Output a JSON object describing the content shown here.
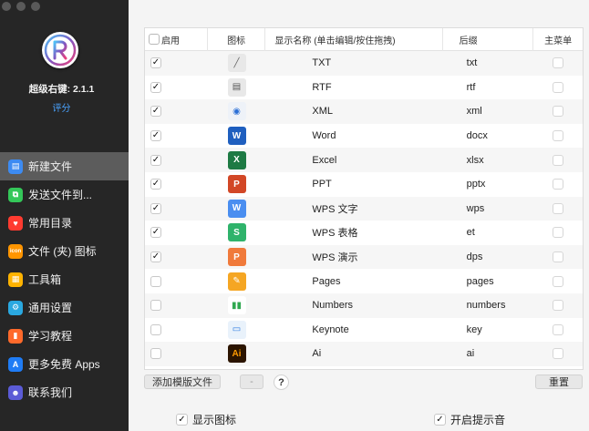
{
  "app": {
    "name": "超级右键: 2.1.1",
    "rate": "评分"
  },
  "nav": [
    {
      "label": "新建文件",
      "icon": "document-icon",
      "color": "#3d8bf2",
      "glyph": "▤",
      "active": true
    },
    {
      "label": "发送文件到...",
      "icon": "send-file-icon",
      "color": "#34c759",
      "glyph": "⧉",
      "active": false
    },
    {
      "label": "常用目录",
      "icon": "heart-icon",
      "color": "#ff3b30",
      "glyph": "♥",
      "active": false
    },
    {
      "label": "文件 (夹) 图标",
      "icon": "icon-badge-icon",
      "color": "#ff9500",
      "glyph": "icon",
      "active": false
    },
    {
      "label": "工具箱",
      "icon": "toolbox-icon",
      "color": "#ffb300",
      "glyph": "▦",
      "active": false
    },
    {
      "label": "通用设置",
      "icon": "gear-icon",
      "color": "#2aa8e0",
      "glyph": "⚙",
      "active": false
    },
    {
      "label": "学习教程",
      "icon": "book-icon",
      "color": "#ff6a2b",
      "glyph": "▮",
      "active": false
    },
    {
      "label": "更多免费 Apps",
      "icon": "app-store-icon",
      "color": "#1f7cf5",
      "glyph": "A",
      "active": false
    },
    {
      "label": "联系我们",
      "icon": "contact-icon",
      "color": "#5b5bd6",
      "glyph": "☻",
      "active": false
    }
  ],
  "table": {
    "headers": {
      "enabled": "启用",
      "icon": "图标",
      "name": "显示名称 (单击编辑/按住拖拽)",
      "suffix": "后缀",
      "main_menu": "主菜单"
    },
    "rows": [
      {
        "enabled": true,
        "name": "TXT",
        "suffix": "txt",
        "icon": "txt-file-icon",
        "color": "#e8e8e8",
        "glyph": "╱",
        "fg": "#666"
      },
      {
        "enabled": true,
        "name": "RTF",
        "suffix": "rtf",
        "icon": "rtf-file-icon",
        "color": "#e8e8e8",
        "glyph": "▤",
        "fg": "#555"
      },
      {
        "enabled": true,
        "name": "XML",
        "suffix": "xml",
        "icon": "xml-file-icon",
        "color": "#eef2f8",
        "glyph": "◉",
        "fg": "#2b6fd6"
      },
      {
        "enabled": true,
        "name": "Word",
        "suffix": "docx",
        "icon": "word-icon",
        "color": "#1f5fbf",
        "glyph": "W",
        "fg": "#fff"
      },
      {
        "enabled": true,
        "name": "Excel",
        "suffix": "xlsx",
        "icon": "excel-icon",
        "color": "#1e7a44",
        "glyph": "X",
        "fg": "#fff"
      },
      {
        "enabled": true,
        "name": "PPT",
        "suffix": "pptx",
        "icon": "powerpoint-icon",
        "color": "#d24726",
        "glyph": "P",
        "fg": "#fff"
      },
      {
        "enabled": true,
        "name": "WPS 文字",
        "suffix": "wps",
        "icon": "wps-writer-icon",
        "color": "#4a8ef0",
        "glyph": "W",
        "fg": "#fff"
      },
      {
        "enabled": true,
        "name": "WPS 表格",
        "suffix": "et",
        "icon": "wps-sheet-icon",
        "color": "#2fb36b",
        "glyph": "S",
        "fg": "#fff"
      },
      {
        "enabled": true,
        "name": "WPS 演示",
        "suffix": "dps",
        "icon": "wps-slides-icon",
        "color": "#f07a3b",
        "glyph": "P",
        "fg": "#fff"
      },
      {
        "enabled": false,
        "name": "Pages",
        "suffix": "pages",
        "icon": "pages-icon",
        "color": "#f5a623",
        "glyph": "✎",
        "fg": "#fff"
      },
      {
        "enabled": false,
        "name": "Numbers",
        "suffix": "numbers",
        "icon": "numbers-icon",
        "color": "#ffffff",
        "glyph": "▮▮",
        "fg": "#2fa84f"
      },
      {
        "enabled": false,
        "name": "Keynote",
        "suffix": "key",
        "icon": "keynote-icon",
        "color": "#e9f2fb",
        "glyph": "▭",
        "fg": "#2d7be0"
      },
      {
        "enabled": false,
        "name": "Ai",
        "suffix": "ai",
        "icon": "illustrator-icon",
        "color": "#2b1400",
        "glyph": "Ai",
        "fg": "#ff9a00"
      }
    ]
  },
  "buttons": {
    "add": "添加模版文件",
    "minus": "-",
    "help": "?",
    "reset": "重置"
  },
  "options": {
    "show_icon": {
      "label": "显示图标",
      "checked": true
    },
    "sound": {
      "label": "开启提示音",
      "checked": true
    }
  }
}
